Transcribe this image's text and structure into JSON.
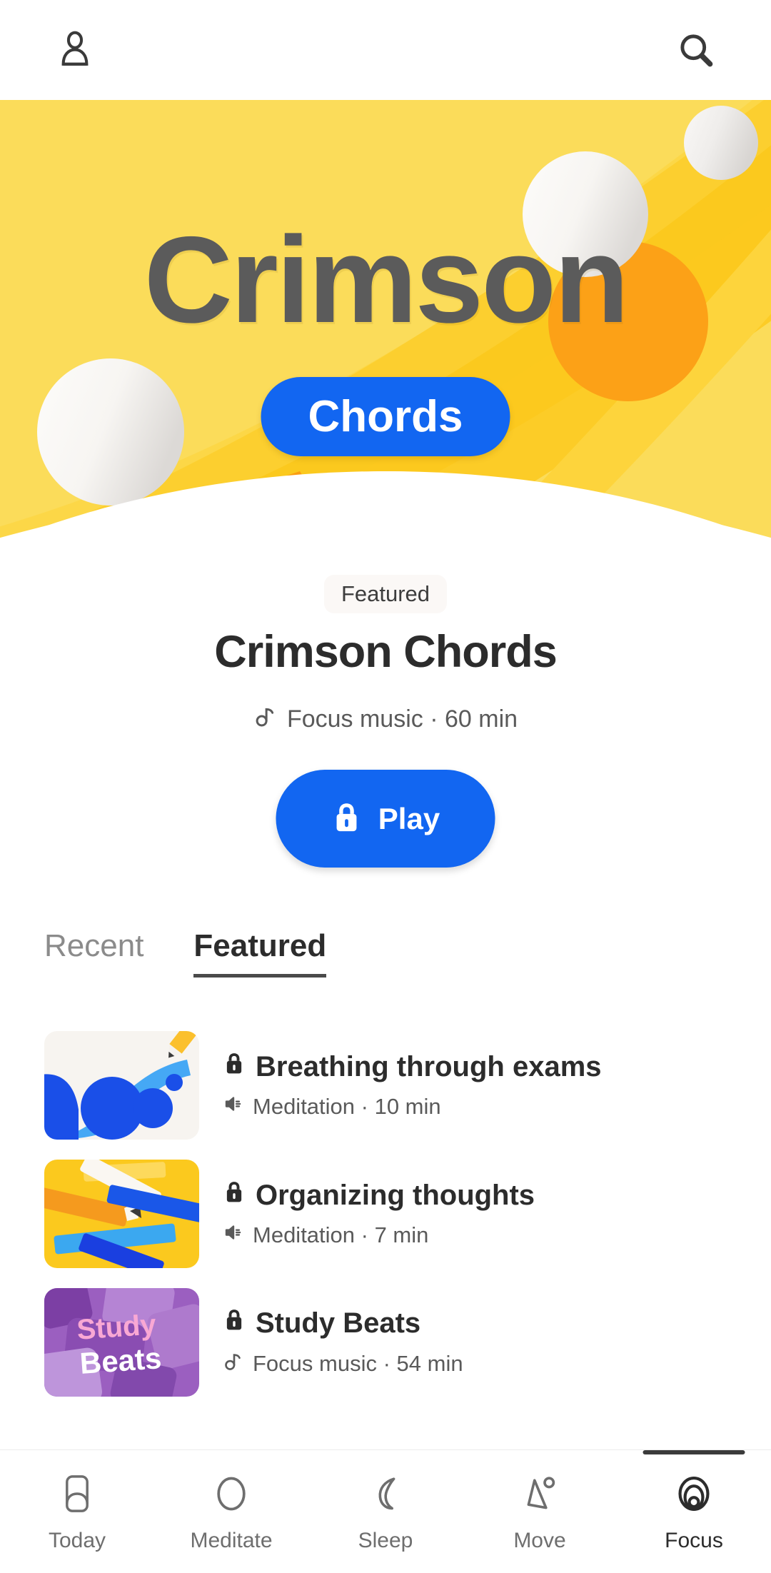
{
  "topbar": {
    "profile_icon": "person-icon",
    "search_icon": "search-icon"
  },
  "hero": {
    "title": "Crimson",
    "badge": "Chords",
    "bg_color": "#FBDC5A",
    "badge_color": "#1266F1",
    "title_color": "#5b5b5b"
  },
  "detail": {
    "chip": "Featured",
    "title": "Crimson Chords",
    "meta_icon": "music-note-icon",
    "meta": "Focus music · 60 min",
    "play_label": "Play",
    "play_icon": "lock-icon",
    "play_color": "#1266F1"
  },
  "tabs": [
    {
      "label": "Recent",
      "active": false
    },
    {
      "label": "Featured",
      "active": true
    }
  ],
  "list": [
    {
      "title": "Breathing through exams",
      "title_icon": "lock-icon",
      "meta_icon": "speaker-icon",
      "meta": "Meditation · 10 min",
      "thumb": "blue-circles-pencil"
    },
    {
      "title": "Organizing thoughts",
      "title_icon": "lock-icon",
      "meta_icon": "speaker-icon",
      "meta": "Meditation · 7 min",
      "thumb": "yellow-scattered-pencils"
    },
    {
      "title": "Study Beats",
      "title_icon": "lock-icon",
      "meta_icon": "music-note-icon",
      "meta": "Focus music · 54 min",
      "thumb": "purple-study-beats",
      "thumb_text_top": "Study",
      "thumb_text_bottom": "Beats"
    }
  ],
  "bottomnav": [
    {
      "label": "Today",
      "icon": "today-card-icon",
      "active": false
    },
    {
      "label": "Meditate",
      "icon": "circle-icon",
      "active": false
    },
    {
      "label": "Sleep",
      "icon": "moon-icon",
      "active": false
    },
    {
      "label": "Move",
      "icon": "mountain-icon",
      "active": false
    },
    {
      "label": "Focus",
      "icon": "concentric-rings-icon",
      "active": true
    }
  ]
}
